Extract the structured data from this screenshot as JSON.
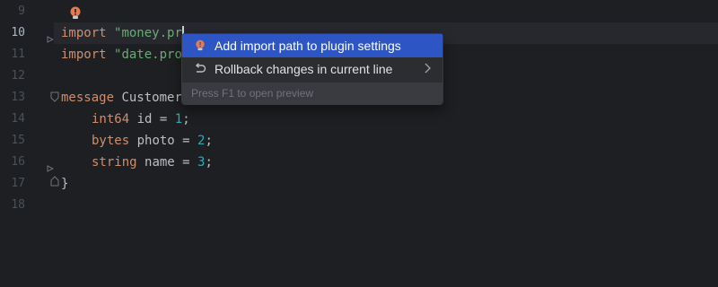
{
  "editor": {
    "line_numbers": [
      "9",
      "10",
      "11",
      "12",
      "13",
      "14",
      "15",
      "16",
      "17",
      "18"
    ],
    "current_line": "10",
    "lines": {
      "l10": {
        "kw": "import",
        "str": "\"money.pr"
      },
      "l11": {
        "kw": "import",
        "str": "\"date.pro"
      },
      "l13": {
        "kw": "message",
        "ident": "Customer"
      },
      "l14": {
        "type": "int64",
        "ident": "id = ",
        "num": "1",
        "end": ";"
      },
      "l15": {
        "type": "bytes",
        "ident": "photo = ",
        "num": "2",
        "end": ";"
      },
      "l16": {
        "type": "string",
        "ident": "name = ",
        "num": "3",
        "end": ";"
      },
      "l17": {
        "brace": "}"
      }
    }
  },
  "popup": {
    "items": [
      {
        "label": "Add import path to plugin settings",
        "icon": "lightbulb-error-icon",
        "selected": true
      },
      {
        "label": "Rollback changes in current line",
        "icon": "rollback-icon",
        "has_submenu": true
      }
    ],
    "footer": "Press F1 to open preview"
  },
  "colors": {
    "background": "#1e1f22",
    "keyword": "#cf8e6d",
    "string": "#6aab73",
    "number": "#2aacb8",
    "selection": "#2e55c4",
    "bulb": "#e07b53"
  }
}
